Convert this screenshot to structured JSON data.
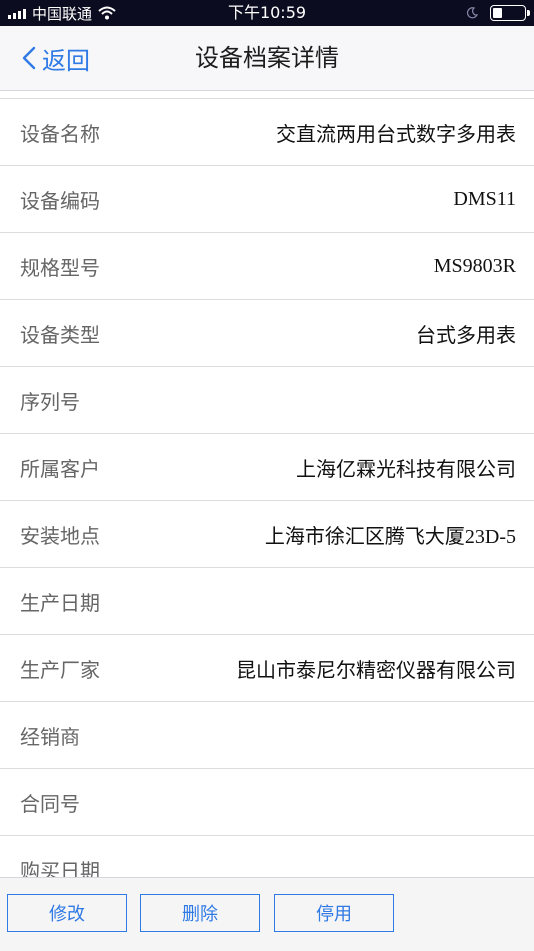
{
  "status_bar": {
    "carrier": "中国联通",
    "time": "下午10:59",
    "battery_level": 0.3
  },
  "nav": {
    "back_label": "返回",
    "title": "设备档案详情"
  },
  "fields": [
    {
      "label": "设备名称",
      "value": "交直流两用台式数字多用表"
    },
    {
      "label": "设备编码",
      "value": "DMS11"
    },
    {
      "label": "规格型号",
      "value": "MS9803R"
    },
    {
      "label": "设备类型",
      "value": "台式多用表"
    },
    {
      "label": "序列号",
      "value": ""
    },
    {
      "label": "所属客户",
      "value": "上海亿霖光科技有限公司"
    },
    {
      "label": "安装地点",
      "value": "上海市徐汇区腾飞大厦23D-5"
    },
    {
      "label": "生产日期",
      "value": ""
    },
    {
      "label": "生产厂家",
      "value": "昆山市泰尼尔精密仪器有限公司"
    },
    {
      "label": "经销商",
      "value": ""
    },
    {
      "label": "合同号",
      "value": ""
    },
    {
      "label": "购买日期",
      "value": ""
    }
  ],
  "toolbar": {
    "edit_label": "修改",
    "delete_label": "删除",
    "disable_label": "停用"
  },
  "colors": {
    "accent": "#2f7ae5",
    "status_bar_bg": "#0c0c20"
  }
}
